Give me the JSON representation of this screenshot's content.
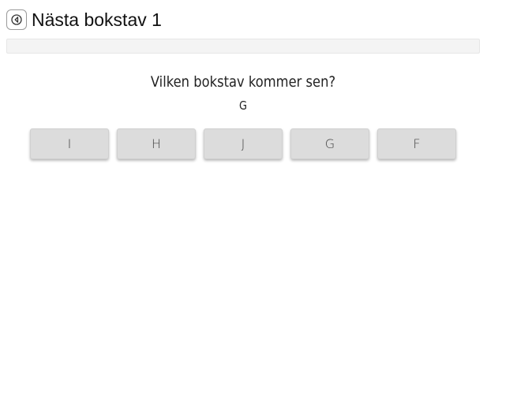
{
  "header": {
    "title": "Nästa bokstav 1",
    "back_icon": "back-arrow-icon"
  },
  "progress": {
    "value_percent": 0
  },
  "question": {
    "text": "Vilken bokstav kommer sen?",
    "letter": "G"
  },
  "options": [
    "I",
    "H",
    "J",
    "G",
    "F"
  ],
  "colors": {
    "button_bg": "#dcdcdc",
    "progress_bg": "#f4f4f4",
    "text": "#222222"
  }
}
